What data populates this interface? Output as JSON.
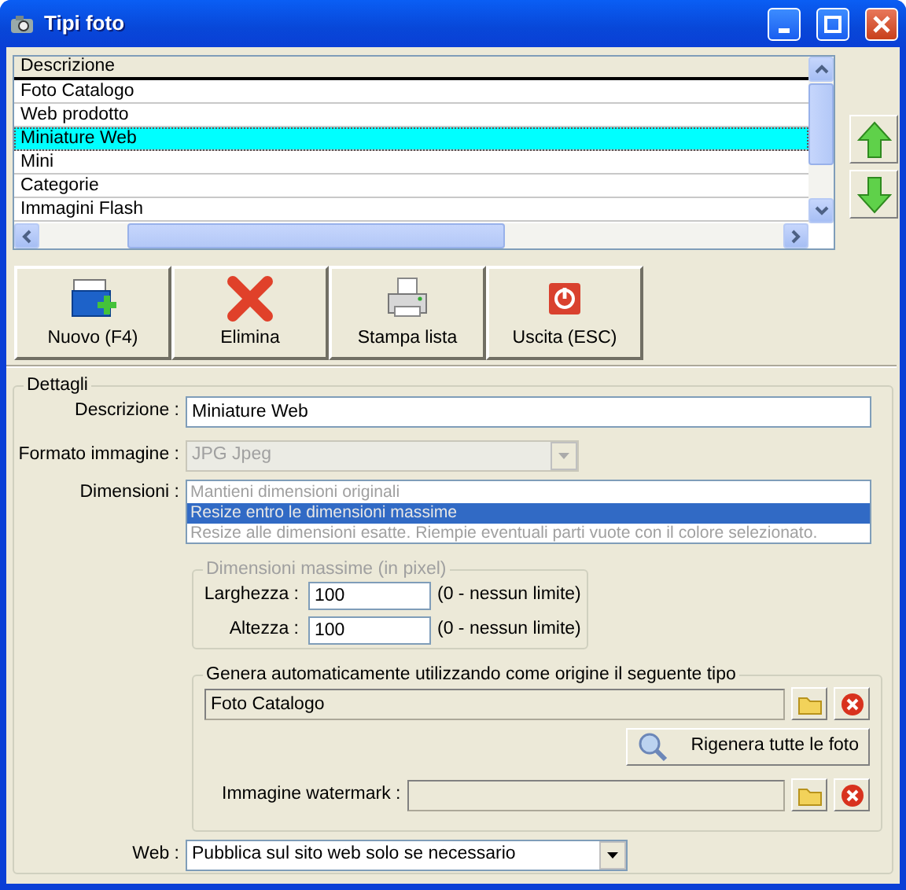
{
  "window": {
    "title": "Tipi foto"
  },
  "list": {
    "columns": [
      "Descrizione"
    ],
    "rows": [
      {
        "label": "Foto Catalogo",
        "selected": false
      },
      {
        "label": "Web prodotto",
        "selected": false
      },
      {
        "label": "Miniature Web",
        "selected": true
      },
      {
        "label": "Mini",
        "selected": false
      },
      {
        "label": "Categorie",
        "selected": false
      },
      {
        "label": "Immagini Flash",
        "selected": false
      }
    ]
  },
  "toolbar": [
    {
      "label": "Nuovo (F4)",
      "kind": "new"
    },
    {
      "label": "Elimina",
      "kind": "delete"
    },
    {
      "label": "Stampa lista",
      "kind": "print"
    },
    {
      "label": "Uscita (ESC)",
      "kind": "exit"
    }
  ],
  "details": {
    "legend": "Dettagli",
    "description": {
      "label": "Descrizione :",
      "value": "Miniature Web"
    },
    "format": {
      "label": "Formato immagine :",
      "value": "JPG Jpeg",
      "disabled": true
    },
    "dimensions": {
      "label": "Dimensioni :",
      "disabled": true,
      "options": [
        {
          "label": "Mantieni dimensioni originali",
          "selected": false
        },
        {
          "label": "Resize entro le dimensioni massime",
          "selected": true
        },
        {
          "label": "Resize alle dimensioni esatte. Riempie eventuali parti vuote con il colore selezionato.",
          "selected": false
        }
      ]
    },
    "max_size": {
      "legend": "Dimensioni massime (in pixel)",
      "disabled": true,
      "fields": [
        {
          "label": "Larghezza :",
          "value": "100",
          "hint": "(0 - nessun limite)"
        },
        {
          "label": "Altezza :",
          "value": "100",
          "hint": "(0 - nessun limite)"
        }
      ]
    },
    "generate": {
      "legend": "Genera automaticamente utilizzando come origine il seguente tipo",
      "source": {
        "value": "Foto Catalogo"
      },
      "regen_button": "Rigenera tutte le foto",
      "watermark": {
        "label": "Immagine watermark :"
      }
    },
    "web": {
      "label": "Web :",
      "value": "Pubblica sul sito web solo se necessario"
    }
  }
}
